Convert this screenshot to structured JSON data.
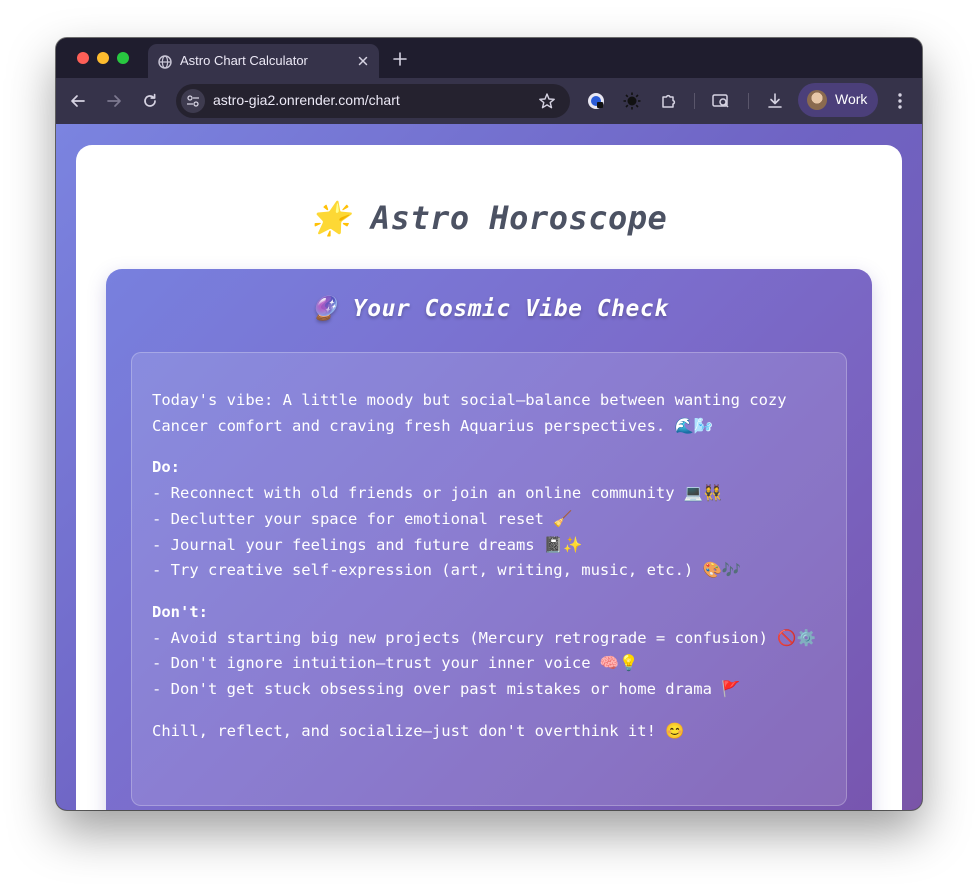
{
  "browser": {
    "tab_title": "Astro Chart Calculator",
    "url": "astro-gia2.onrender.com/chart",
    "profile_label": "Work"
  },
  "page": {
    "title": "🌟 Astro Horoscope"
  },
  "vibe_check": {
    "heading": "🔮 Your Cosmic Vibe Check",
    "intro": "Today's vibe: A little moody but social—balance between wanting cozy Cancer comfort and craving fresh Aquarius perspectives. 🌊🌬️",
    "do_heading": "Do:",
    "do_items": [
      "- Reconnect with old friends or join an online community 💻👯",
      "- Declutter your space for emotional reset 🧹",
      "- Journal your feelings and future dreams 📓✨",
      "- Try creative self-expression (art, writing, music, etc.) 🎨🎶"
    ],
    "dont_heading": "Don't:",
    "dont_items": [
      "- Avoid starting big new projects (Mercury retrograde = confusion) 🚫⚙️",
      "- Don't ignore intuition—trust your inner voice 🧠💡",
      "- Don't get stuck obsessing over past mistakes or home drama 🚩"
    ],
    "closing": "Chill, reflect, and socialize—just don't overthink it! 😊"
  },
  "colors": {
    "page_gradient": [
      "#7b84e0",
      "#7a55a8"
    ],
    "tab_strip": "#1f1d2e",
    "toolbar": "#36334a",
    "title_text": "#4c5263"
  },
  "icons": [
    "globe-icon",
    "close-icon",
    "plus-icon",
    "back-arrow-icon",
    "forward-arrow-icon",
    "reload-icon",
    "tune-icon",
    "star-icon",
    "extension-shield-icon",
    "sun-extension-icon",
    "puzzle-icon",
    "search-tab-icon",
    "download-icon",
    "more-vertical-icon"
  ]
}
